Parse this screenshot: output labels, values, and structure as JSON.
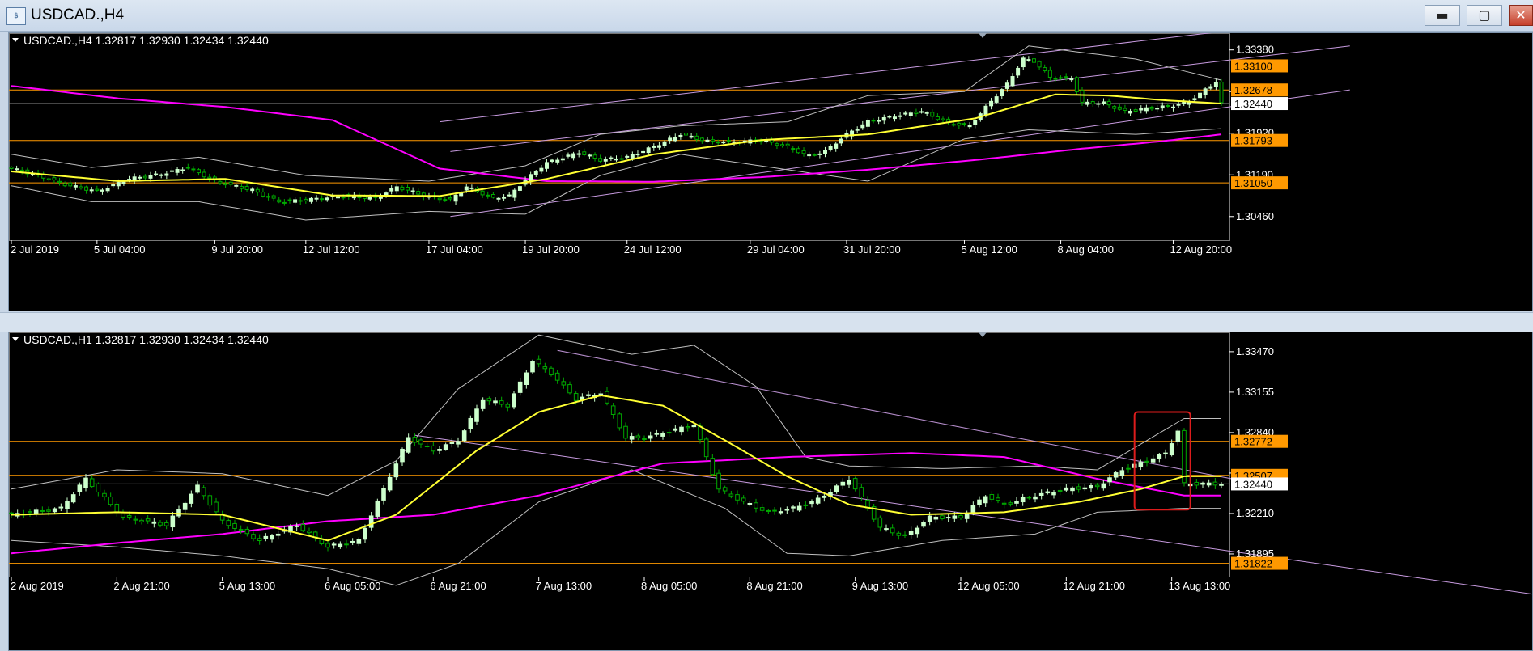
{
  "window": {
    "icon": "chart-app-icon",
    "title": "USDCAD.,H4",
    "buttons": [
      "minimize-icon",
      "maximize-icon",
      "close-icon"
    ],
    "button_glyphs": {
      "minimize": "▬",
      "maximize": "▢",
      "close": "✕"
    }
  },
  "colors": {
    "background": "#000000",
    "bull": "#ccffcc",
    "bear": "#00aa00",
    "ma_fast": "#ffff33",
    "ma_slow": "#ff00ff",
    "bands": "#bfbfbf",
    "channel": "#c89be0",
    "level_line": "#ff9900",
    "level_tag": "#ff9900",
    "current_tag": "#ffffff",
    "highlight_box": "#dd1c1c"
  },
  "chart_data": [
    {
      "type": "candlestick",
      "header": "USDCAD.,H4  1.32817 1.32930 1.32434 1.32440",
      "ylim": [
        1.3006,
        1.3356
      ],
      "yticks": [
        "1.33380",
        "1.32650",
        "1.31920",
        "1.31190",
        "1.30460"
      ],
      "ytick_values": [
        1.3338,
        1.3265,
        1.3192,
        1.3119,
        1.3046
      ],
      "price_tags": [
        {
          "text": "1.33100",
          "value": 1.331,
          "kind": "level"
        },
        {
          "text": "1.32678",
          "value": 1.32678,
          "kind": "level"
        },
        {
          "text": "1.32440",
          "value": 1.3244,
          "kind": "current"
        },
        {
          "text": "1.31793",
          "value": 1.31793,
          "kind": "level"
        },
        {
          "text": "1.31050",
          "value": 1.3105,
          "kind": "level"
        }
      ],
      "xticks": [
        "2 Jul 2019",
        "5 Jul 04:00",
        "9 Jul 20:00",
        "12 Jul 12:00",
        "17 Jul 04:00",
        "19 Jul 20:00",
        "24 Jul 12:00",
        "29 Jul 04:00",
        "31 Jul 20:00",
        "5 Aug 12:00",
        "8 Aug 04:00",
        "12 Aug 20:00"
      ],
      "xtick_index": [
        0,
        16,
        38,
        55,
        78,
        96,
        115,
        138,
        156,
        178,
        196,
        217
      ],
      "bar_count": 227,
      "close_anchors": [
        [
          0,
          1.313
        ],
        [
          5,
          1.3118
        ],
        [
          10,
          1.3102
        ],
        [
          16,
          1.309
        ],
        [
          22,
          1.3112
        ],
        [
          28,
          1.312
        ],
        [
          33,
          1.3132
        ],
        [
          38,
          1.3108
        ],
        [
          45,
          1.3092
        ],
        [
          50,
          1.3072
        ],
        [
          55,
          1.3075
        ],
        [
          62,
          1.3082
        ],
        [
          68,
          1.3078
        ],
        [
          72,
          1.3098
        ],
        [
          78,
          1.308
        ],
        [
          82,
          1.3075
        ],
        [
          85,
          1.3098
        ],
        [
          90,
          1.3078
        ],
        [
          93,
          1.3082
        ],
        [
          96,
          1.311
        ],
        [
          100,
          1.314
        ],
        [
          106,
          1.3158
        ],
        [
          110,
          1.3145
        ],
        [
          115,
          1.315
        ],
        [
          120,
          1.3168
        ],
        [
          125,
          1.319
        ],
        [
          130,
          1.3178
        ],
        [
          135,
          1.3176
        ],
        [
          140,
          1.318
        ],
        [
          145,
          1.3168
        ],
        [
          149,
          1.3152
        ],
        [
          152,
          1.316
        ],
        [
          156,
          1.319
        ],
        [
          160,
          1.3212
        ],
        [
          165,
          1.3222
        ],
        [
          170,
          1.323
        ],
        [
          175,
          1.321
        ],
        [
          179,
          1.3205
        ],
        [
          183,
          1.3248
        ],
        [
          186,
          1.3278
        ],
        [
          189,
          1.3322
        ],
        [
          191,
          1.3318
        ],
        [
          194,
          1.329
        ],
        [
          198,
          1.3288
        ],
        [
          200,
          1.3245
        ],
        [
          204,
          1.3245
        ],
        [
          208,
          1.323
        ],
        [
          212,
          1.3235
        ],
        [
          217,
          1.324
        ],
        [
          220,
          1.3248
        ],
        [
          223,
          1.3268
        ],
        [
          225,
          1.3282
        ],
        [
          226,
          1.3244
        ]
      ],
      "ma_fast_anchors": [
        [
          0,
          1.3125
        ],
        [
          20,
          1.3108
        ],
        [
          40,
          1.3112
        ],
        [
          60,
          1.3083
        ],
        [
          80,
          1.3082
        ],
        [
          100,
          1.3112
        ],
        [
          120,
          1.3155
        ],
        [
          140,
          1.318
        ],
        [
          160,
          1.319
        ],
        [
          180,
          1.3218
        ],
        [
          195,
          1.326
        ],
        [
          205,
          1.3258
        ],
        [
          215,
          1.325
        ],
        [
          226,
          1.3244
        ]
      ],
      "ma_slow_anchors": [
        [
          0,
          1.3275
        ],
        [
          20,
          1.3253
        ],
        [
          40,
          1.3238
        ],
        [
          60,
          1.3215
        ],
        [
          80,
          1.313
        ],
        [
          100,
          1.3108
        ],
        [
          120,
          1.3107
        ],
        [
          140,
          1.3115
        ],
        [
          160,
          1.3128
        ],
        [
          180,
          1.3145
        ],
        [
          200,
          1.3165
        ],
        [
          215,
          1.3178
        ],
        [
          226,
          1.319
        ]
      ],
      "band_upper_anchors": [
        [
          0,
          1.3155
        ],
        [
          15,
          1.3132
        ],
        [
          35,
          1.315
        ],
        [
          55,
          1.3118
        ],
        [
          78,
          1.3108
        ],
        [
          96,
          1.3135
        ],
        [
          110,
          1.319
        ],
        [
          125,
          1.3205
        ],
        [
          145,
          1.3212
        ],
        [
          160,
          1.3258
        ],
        [
          178,
          1.3265
        ],
        [
          190,
          1.3345
        ],
        [
          210,
          1.3322
        ],
        [
          226,
          1.3285
        ]
      ],
      "band_lower_anchors": [
        [
          0,
          1.31
        ],
        [
          15,
          1.3072
        ],
        [
          35,
          1.3072
        ],
        [
          55,
          1.304
        ],
        [
          78,
          1.3055
        ],
        [
          96,
          1.305
        ],
        [
          110,
          1.3118
        ],
        [
          125,
          1.3155
        ],
        [
          145,
          1.3128
        ],
        [
          160,
          1.3108
        ],
        [
          178,
          1.3182
        ],
        [
          190,
          1.3198
        ],
        [
          210,
          1.319
        ],
        [
          226,
          1.32
        ]
      ],
      "channel_lines": [
        [
          [
            80,
            1.3212
          ],
          [
            226,
            1.337
          ]
        ],
        [
          [
            82,
            1.316
          ],
          [
            250,
            1.3345
          ]
        ],
        [
          [
            82,
            1.3046
          ],
          [
            250,
            1.3268
          ]
        ]
      ]
    },
    {
      "type": "candlestick",
      "header": "USDCAD.,H1  1.32817 1.32930 1.32434 1.32440",
      "ylim": [
        1.3175,
        1.3357
      ],
      "yticks": [
        "1.33470",
        "1.33155",
        "1.32840",
        "1.32525",
        "1.32210",
        "1.31895"
      ],
      "ytick_values": [
        1.3347,
        1.33155,
        1.3284,
        1.32525,
        1.3221,
        1.31895
      ],
      "price_tags": [
        {
          "text": "1.32772",
          "value": 1.32772,
          "kind": "level"
        },
        {
          "text": "1.32507",
          "value": 1.32507,
          "kind": "level"
        },
        {
          "text": "1.32440",
          "value": 1.3244,
          "kind": "current"
        },
        {
          "text": "1.31822",
          "value": 1.31822,
          "kind": "level"
        }
      ],
      "xticks": [
        "2 Aug 2019",
        "2 Aug 21:00",
        "5 Aug 13:00",
        "6 Aug 05:00",
        "6 Aug 21:00",
        "7 Aug 13:00",
        "8 Aug 05:00",
        "8 Aug 21:00",
        "9 Aug 13:00",
        "12 Aug 05:00",
        "12 Aug 21:00",
        "13 Aug 13:00"
      ],
      "xtick_index": [
        0,
        17,
        34,
        51,
        68,
        85,
        102,
        119,
        136,
        153,
        170,
        187
      ],
      "bar_count": 196,
      "close_anchors": [
        [
          0,
          1.322
        ],
        [
          8,
          1.3225
        ],
        [
          12,
          1.3248
        ],
        [
          18,
          1.3218
        ],
        [
          25,
          1.3212
        ],
        [
          30,
          1.3242
        ],
        [
          34,
          1.3215
        ],
        [
          40,
          1.32
        ],
        [
          46,
          1.3212
        ],
        [
          51,
          1.3195
        ],
        [
          56,
          1.32
        ],
        [
          60,
          1.324
        ],
        [
          64,
          1.328
        ],
        [
          68,
          1.327
        ],
        [
          72,
          1.3278
        ],
        [
          76,
          1.331
        ],
        [
          80,
          1.3305
        ],
        [
          84,
          1.334
        ],
        [
          87,
          1.333
        ],
        [
          91,
          1.331
        ],
        [
          95,
          1.3315
        ],
        [
          99,
          1.328
        ],
        [
          102,
          1.328
        ],
        [
          106,
          1.3285
        ],
        [
          110,
          1.329
        ],
        [
          114,
          1.324
        ],
        [
          118,
          1.323
        ],
        [
          122,
          1.3222
        ],
        [
          126,
          1.3225
        ],
        [
          130,
          1.3232
        ],
        [
          135,
          1.3248
        ],
        [
          140,
          1.321
        ],
        [
          144,
          1.3203
        ],
        [
          148,
          1.3218
        ],
        [
          153,
          1.3218
        ],
        [
          157,
          1.3235
        ],
        [
          160,
          1.3228
        ],
        [
          165,
          1.3235
        ],
        [
          170,
          1.324
        ],
        [
          175,
          1.3242
        ],
        [
          179,
          1.3255
        ],
        [
          183,
          1.3262
        ],
        [
          186,
          1.3268
        ],
        [
          188,
          1.3285
        ],
        [
          189,
          1.3244
        ]
      ],
      "ma_fast_anchors": [
        [
          0,
          1.322
        ],
        [
          17,
          1.3222
        ],
        [
          34,
          1.322
        ],
        [
          51,
          1.32
        ],
        [
          62,
          1.322
        ],
        [
          75,
          1.327
        ],
        [
          85,
          1.33
        ],
        [
          95,
          1.3313
        ],
        [
          105,
          1.3305
        ],
        [
          115,
          1.3278
        ],
        [
          125,
          1.325
        ],
        [
          135,
          1.3228
        ],
        [
          145,
          1.322
        ],
        [
          160,
          1.3222
        ],
        [
          172,
          1.323
        ],
        [
          182,
          1.324
        ],
        [
          189,
          1.325
        ]
      ],
      "ma_slow_anchors": [
        [
          0,
          1.319
        ],
        [
          17,
          1.3198
        ],
        [
          34,
          1.3205
        ],
        [
          51,
          1.3215
        ],
        [
          68,
          1.322
        ],
        [
          85,
          1.3235
        ],
        [
          105,
          1.326
        ],
        [
          125,
          1.3265
        ],
        [
          145,
          1.3268
        ],
        [
          160,
          1.3265
        ],
        [
          175,
          1.3248
        ],
        [
          189,
          1.3235
        ]
      ],
      "band_upper_anchors": [
        [
          0,
          1.324
        ],
        [
          17,
          1.3255
        ],
        [
          34,
          1.3252
        ],
        [
          51,
          1.3235
        ],
        [
          62,
          1.3262
        ],
        [
          72,
          1.3318
        ],
        [
          85,
          1.336
        ],
        [
          100,
          1.3345
        ],
        [
          110,
          1.3352
        ],
        [
          120,
          1.332
        ],
        [
          128,
          1.3265
        ],
        [
          135,
          1.3258
        ],
        [
          150,
          1.3256
        ],
        [
          165,
          1.3258
        ],
        [
          175,
          1.3255
        ],
        [
          189,
          1.3295
        ]
      ],
      "band_lower_anchors": [
        [
          0,
          1.32
        ],
        [
          17,
          1.3195
        ],
        [
          34,
          1.3188
        ],
        [
          51,
          1.3178
        ],
        [
          62,
          1.3165
        ],
        [
          72,
          1.3182
        ],
        [
          85,
          1.323
        ],
        [
          100,
          1.3255
        ],
        [
          115,
          1.3225
        ],
        [
          125,
          1.319
        ],
        [
          135,
          1.3188
        ],
        [
          150,
          1.32
        ],
        [
          165,
          1.3205
        ],
        [
          175,
          1.3222
        ],
        [
          189,
          1.3225
        ]
      ],
      "channel_lines": [
        [
          [
            88,
            1.3348
          ],
          [
            200,
            1.3245
          ]
        ],
        [
          [
            65,
            1.3282
          ],
          [
            260,
            1.3148
          ]
        ]
      ],
      "highlight_box": {
        "x": [
          181,
          190
        ],
        "y": [
          1.33,
          1.3224
        ]
      }
    }
  ]
}
